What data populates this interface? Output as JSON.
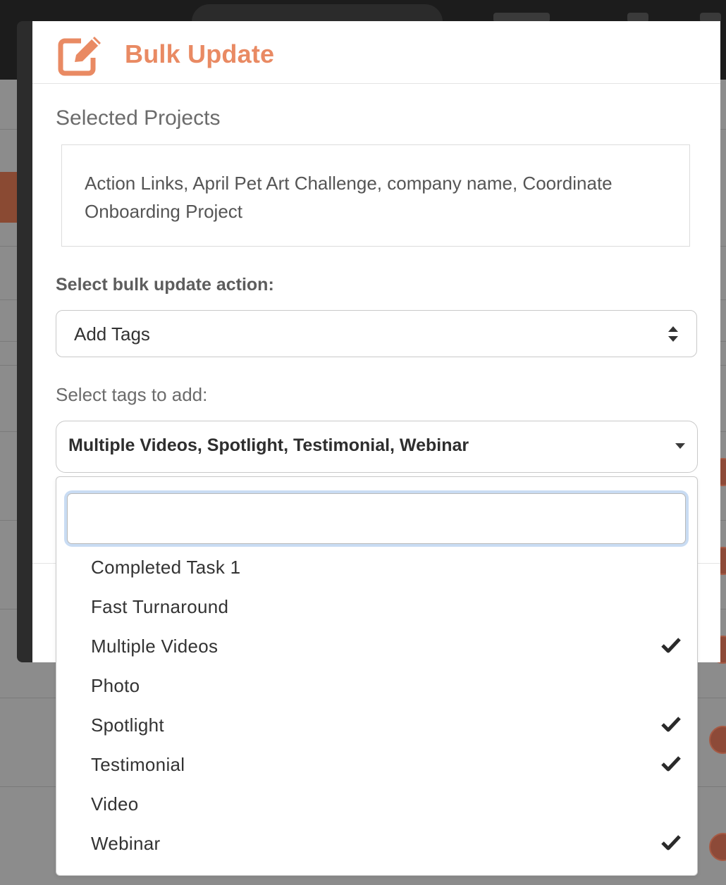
{
  "modal": {
    "title": "Bulk Update",
    "title_icon": "edit-icon",
    "selected_projects_label": "Selected Projects",
    "selected_projects_text": "Action Links, April Pet Art Challenge, company name, Coordinate Onboarding Project",
    "action_label": "Select bulk update action:",
    "action_value": "Add Tags",
    "tags_label": "Select tags to add:",
    "tags_value": "Multiple Videos, Spotlight, Testimonial, Webinar"
  },
  "dropdown": {
    "search_value": "",
    "options": [
      {
        "label": "Completed Task 1",
        "selected": false
      },
      {
        "label": "Fast Turnaround",
        "selected": false
      },
      {
        "label": "Multiple Videos",
        "selected": true
      },
      {
        "label": "Photo",
        "selected": false
      },
      {
        "label": "Spotlight",
        "selected": true
      },
      {
        "label": "Testimonial",
        "selected": true
      },
      {
        "label": "Video",
        "selected": false
      },
      {
        "label": "Webinar",
        "selected": true
      }
    ]
  },
  "colors": {
    "accent": "#e98a63",
    "overlay": "#8c8c8c",
    "focus_ring": "#c9dcf3"
  }
}
